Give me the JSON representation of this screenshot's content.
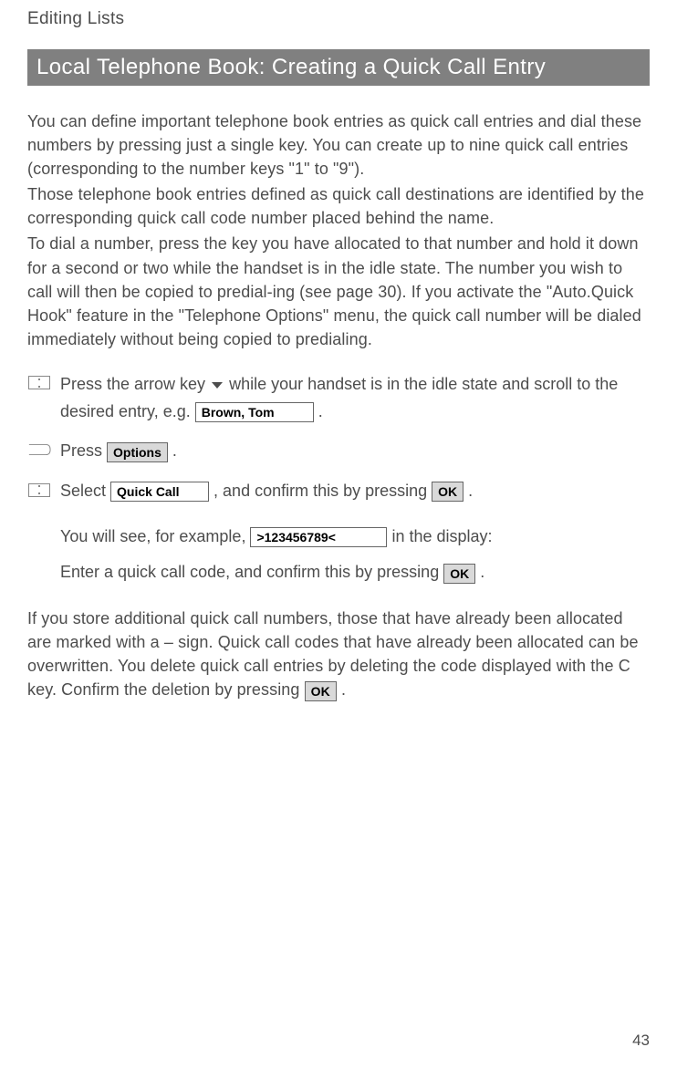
{
  "chapter_title": "Editing Lists",
  "section_title": "Local Telephone Book: Creating a Quick Call Entry",
  "intro": {
    "p1": "You can define important telephone book entries as quick call entries and dial these numbers by pressing just a single key. You can create up to nine quick call entries (corresponding to the number keys \"1\" to \"9\").",
    "p2": "Those telephone book entries defined as quick call destinations are identified by the corresponding quick call code number placed behind the name.",
    "p3": "To dial a number, press the key you have allocated to that number and hold it down for a second or two while the handset is in the idle state. The number you wish to call will then be copied to predial-ing (see page 30). If you activate the \"Auto.Quick Hook\" feature in the \"Telephone Options\" menu, the quick call number will be dialed immediately without being copied to predialing."
  },
  "steps": {
    "step1": {
      "t1": "Press the arrow key ",
      "t2": " while your handset is in the idle state and scroll to the desired entry, e.g. ",
      "entry": "Brown, Tom",
      "t3": " ."
    },
    "step2": {
      "t1": "Press ",
      "options": "Options",
      "t2": " ."
    },
    "step3": {
      "t1": " Select ",
      "quickcall": "Quick Call",
      "t2": ", and confirm this by pressing ",
      "ok": "OK",
      "t3": " ."
    },
    "step4a": {
      "t1": "You will see, for example, ",
      "num": ">123456789<",
      "t2": " in the display:"
    },
    "step4b": {
      "t1": "Enter a quick call code, and confirm this by pressing ",
      "ok": "OK",
      "t2": "  ."
    }
  },
  "closing": {
    "p1a": "If you store additional quick call numbers, those that have already been allocated are marked with a – sign. Quick call codes that have already been allocated can be overwritten. You delete quick call entries by deleting the code displayed with the C key. Confirm the deletion by pressing ",
    "ok": "OK",
    "p1b": "  ."
  },
  "page_number": "43"
}
